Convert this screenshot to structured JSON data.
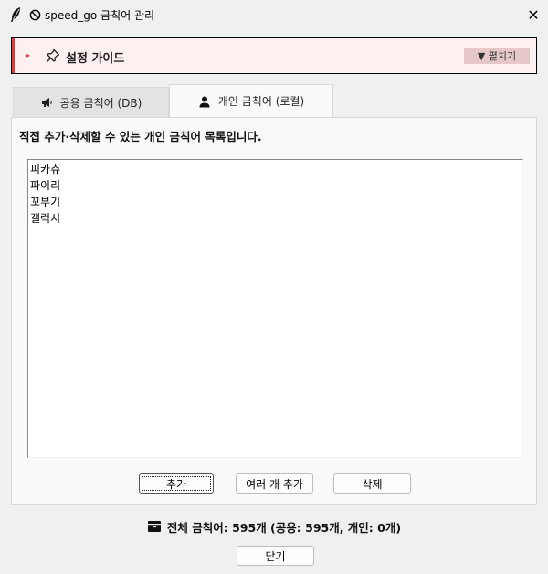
{
  "window": {
    "title": "speed_go 금칙어 관리",
    "close_glyph": "✕",
    "app_icon": "feather-icon",
    "title_icon": "prohibited-icon"
  },
  "guide": {
    "arrow": "▸",
    "icon": "pushpin-icon",
    "title": "설정 가이드",
    "expand_label": "▼ 펼치기",
    "accent_color": "#e03c3c"
  },
  "tabs": [
    {
      "label": "공용 금칙어 (DB)",
      "icon": "megaphone-icon",
      "active": false
    },
    {
      "label": "개인 금칙어 (로컬)",
      "icon": "person-icon",
      "active": true
    }
  ],
  "personal_tab": {
    "description": "직접 추가·삭제할 수 있는 개인 금칙어 목록입니다.",
    "words": [
      "피카츄",
      "파이리",
      "꼬부기",
      "갤럭시"
    ],
    "add_label": "추가",
    "add_multiple_label": "여러 개 추가",
    "delete_label": "삭제"
  },
  "summary": {
    "icon": "package-icon",
    "text": "전체 금칙어: 595개 (공용: 595개, 개인: 0개)"
  },
  "footer": {
    "close_label": "닫기"
  }
}
